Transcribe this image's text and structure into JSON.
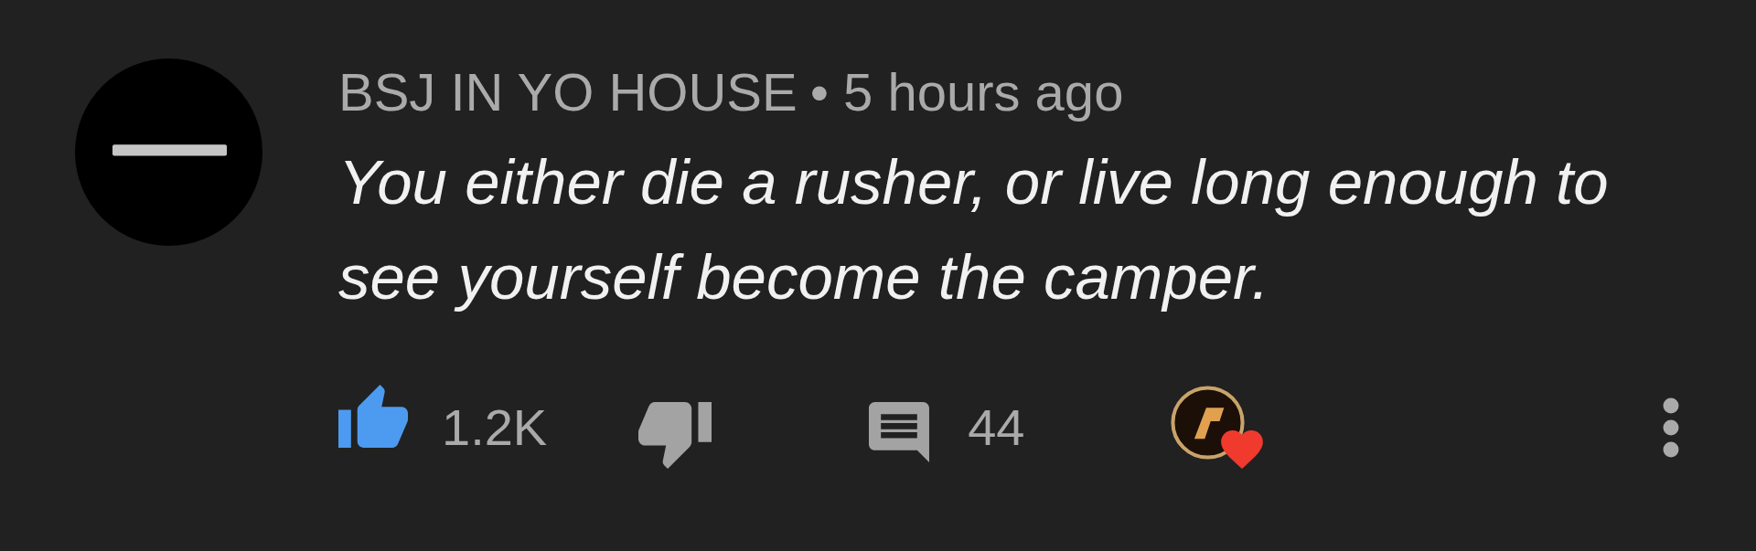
{
  "comment": {
    "author": "BSJ IN YO HOUSE",
    "separator": "•",
    "time": "5 hours ago",
    "text": "You either die a rusher, or live long enough to see yourself become the camper."
  },
  "actions": {
    "liked": true,
    "like_count": "1.2K",
    "disliked": false,
    "reply_count": "44",
    "creator_heart": true
  }
}
